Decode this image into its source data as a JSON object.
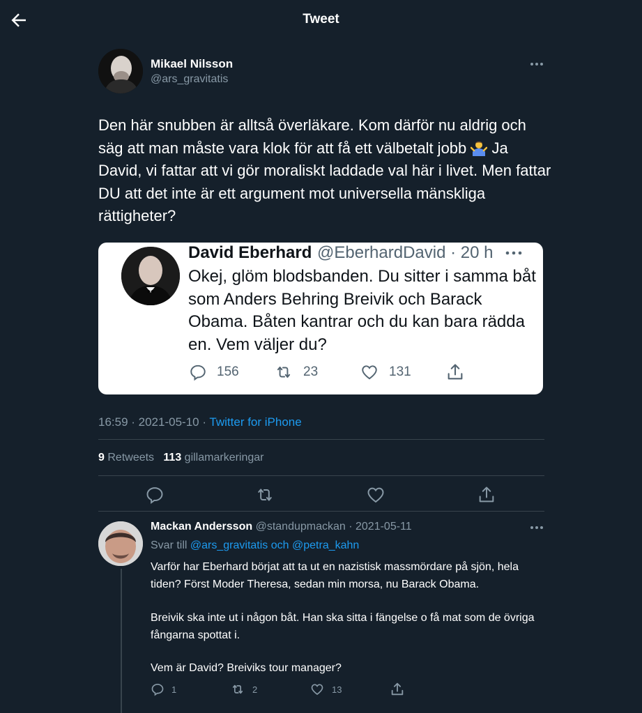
{
  "header": {
    "title": "Tweet"
  },
  "author": {
    "name": "Mikael Nilsson",
    "handle": "@ars_gravitatis"
  },
  "tweet": {
    "text_before_emoji": "Den här snubben är alltså överläkare. Kom därför nu aldrig och säg att man måste vara klok för att få ett välbetalt jobb ",
    "text_after_emoji": " Ja David, vi fattar att vi gör moraliskt laddade val här i livet. Men fattar DU att det inte är ett argument mot universella mänskliga rättigheter?",
    "emoji": "person-shrugging-emoji"
  },
  "embedded_image": {
    "name": "David Eberhard",
    "handle_time": "@EberhardDavid · 20 h",
    "more": "···",
    "text": "Okej, glöm blodsbanden. Du sitter i samma båt som Anders Behring Breivik och Barack Obama. Båten kantrar och du kan bara rädda en. Vem väljer du?",
    "replies": "156",
    "retweets": "23",
    "likes": "131"
  },
  "meta": {
    "time": "16:59 · 2021-05-10 · ",
    "source": "Twitter for iPhone"
  },
  "counts": {
    "retweets_num": "9",
    "retweets_label": "Retweets",
    "likes_num": "113",
    "likes_label": "gillamarkeringar"
  },
  "reply": {
    "name": "Mackan Andersson",
    "handle_date": "@standupmackan · 2021-05-11",
    "reply_to_label": "Svar till",
    "reply_to_user1": "@ars_gravitatis",
    "reply_to_and": "och",
    "reply_to_user2": "@petra_kahn",
    "paragraph1": "Varför har Eberhard börjat att ta ut en nazistisk massmördare på sjön, hela tiden? Först Moder Theresa, sedan min morsa, nu Barack Obama.",
    "paragraph2": "Breivik ska inte ut i någon båt. Han ska sitta i fängelse o få mat som de övriga fångarna spottat i.",
    "paragraph3": "Vem är David? Breiviks tour manager?",
    "replies": "1",
    "retweets": "2",
    "likes": "13"
  },
  "colors": {
    "background": "#15202b",
    "accent": "#1d9bf0",
    "secondary_text": "#8899a6",
    "divider": "#38444d"
  }
}
